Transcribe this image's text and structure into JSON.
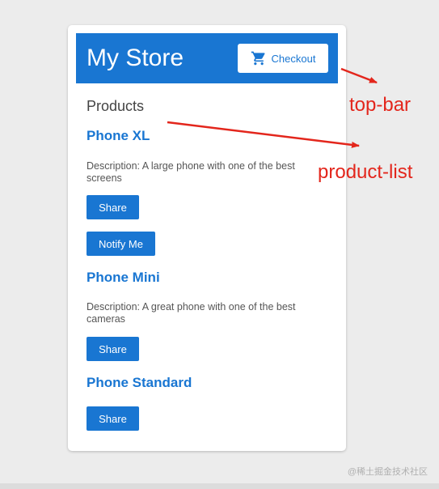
{
  "store": {
    "title": "My Store",
    "checkout_label": "Checkout",
    "checkout_icon": "cart-icon"
  },
  "products_heading": "Products",
  "products": [
    {
      "name": "Phone XL",
      "description": "Description: A large phone with one of the best screens",
      "share_label": "Share",
      "notify_label": "Notify Me"
    },
    {
      "name": "Phone Mini",
      "description": "Description: A great phone with one of the best cameras",
      "share_label": "Share"
    },
    {
      "name": "Phone Standard",
      "share_label": "Share"
    }
  ],
  "annotations": {
    "top_bar": "top-bar",
    "product_list": "product-list"
  },
  "watermark": "@稀土掘金技术社区",
  "colors": {
    "primary": "#1976d2",
    "annotation": "#e3261c",
    "background": "#ececec"
  }
}
